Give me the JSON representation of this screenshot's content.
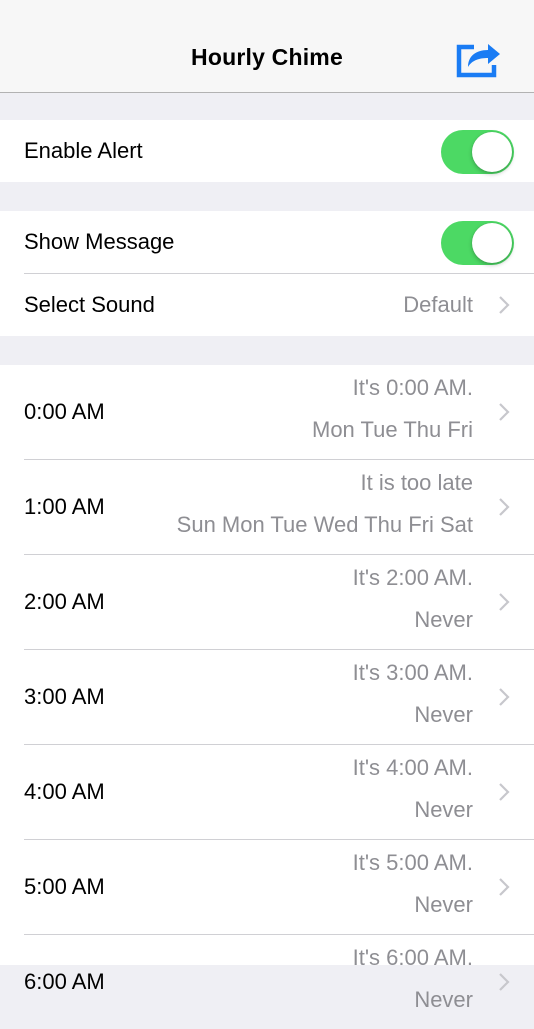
{
  "header": {
    "title": "Hourly Chime",
    "share_icon": "share-icon"
  },
  "settings": {
    "enable_alert": {
      "label": "Enable Alert",
      "on": true
    },
    "show_message": {
      "label": "Show Message",
      "on": true
    },
    "select_sound": {
      "label": "Select Sound",
      "value": "Default"
    }
  },
  "schedule": [
    {
      "time": "0:00 AM",
      "message": "It's 0:00 AM.",
      "days": "Mon Tue Thu Fri"
    },
    {
      "time": "1:00 AM",
      "message": "It is too late",
      "days": "Sun Mon Tue Wed Thu Fri Sat"
    },
    {
      "time": "2:00 AM",
      "message": "It's 2:00 AM.",
      "days": "Never"
    },
    {
      "time": "3:00 AM",
      "message": "It's 3:00 AM.",
      "days": "Never"
    },
    {
      "time": "4:00 AM",
      "message": "It's 4:00 AM.",
      "days": "Never"
    },
    {
      "time": "5:00 AM",
      "message": "It's 5:00 AM.",
      "days": "Never"
    },
    {
      "time": "6:00 AM",
      "message": "It's 6:00 AM.",
      "days": "Never"
    }
  ],
  "colors": {
    "accent": "#1a7cf4",
    "toggle_on": "#4cd964",
    "secondary_text": "#8e8e93"
  }
}
